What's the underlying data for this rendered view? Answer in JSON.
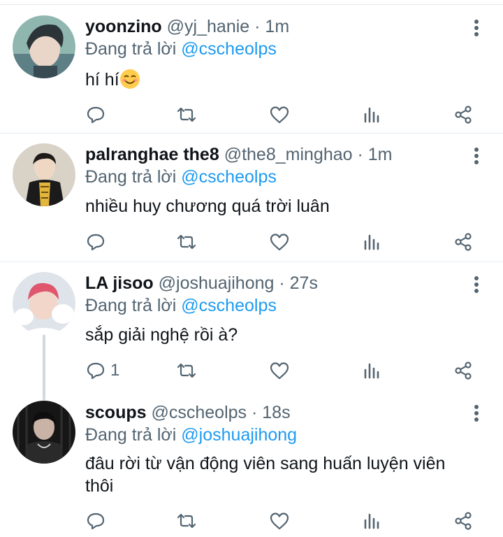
{
  "reply_prefix": "Đang trả lời",
  "tweets": [
    {
      "display_name": "yoonzino",
      "handle": "@yj_hanie",
      "separator": "·",
      "time": "1m",
      "replying_to": "@cscheolps",
      "text": "hí hí",
      "emoji": "smiling-face-with-smiling-eyes",
      "reply_count": ""
    },
    {
      "display_name": "palranghae the8",
      "handle": "@the8_minghao",
      "separator": "·",
      "time": "1m",
      "replying_to": "@cscheolps",
      "text": "nhiều huy chương quá trời luân",
      "reply_count": ""
    },
    {
      "display_name": "LA jisoo",
      "handle": "@joshuajihong",
      "separator": "·",
      "time": "27s",
      "replying_to": "@cscheolps",
      "text": "sắp giải nghệ rồi à?",
      "reply_count": "1"
    },
    {
      "display_name": "scoups",
      "handle": "@cscheolps",
      "separator": "·",
      "time": "18s",
      "replying_to": "@joshuajihong",
      "text_line1": "đâu rời từ vận động viên sang huấn luyện viên",
      "text_line2": "thôi",
      "reply_count": ""
    }
  ],
  "icons": {
    "more": "more-vertical-icon",
    "reply": "reply-icon",
    "retweet": "retweet-icon",
    "like": "like-icon",
    "views": "views-icon",
    "share": "share-icon"
  },
  "colors": {
    "accent": "#1d9bf0",
    "muted": "#536471",
    "text": "#0f1419",
    "divider": "#e6ecf0"
  }
}
